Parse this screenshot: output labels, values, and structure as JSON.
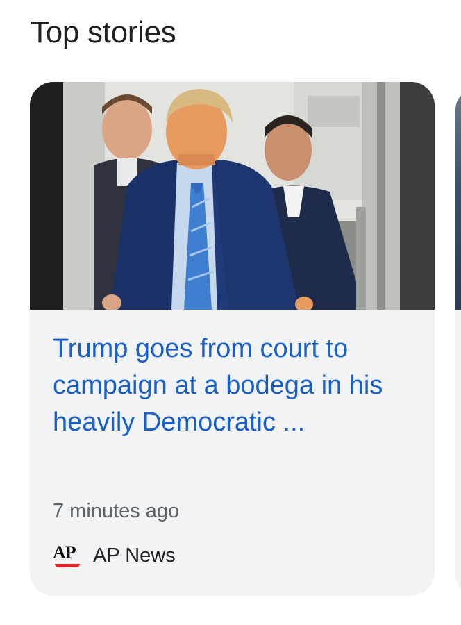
{
  "section": {
    "title": "Top stories"
  },
  "story": {
    "headline": "Trump goes from court to campaign at a bodega in his heavily Democratic ...",
    "timestamp": "7 minutes ago",
    "source": {
      "logo_text": "AP",
      "name": "AP News"
    },
    "image": {
      "description_icon": "news-photo"
    }
  },
  "colors": {
    "headline": "#1a5fc8",
    "card_background": "#f1f3f4",
    "ap_accent": "#e02020"
  }
}
